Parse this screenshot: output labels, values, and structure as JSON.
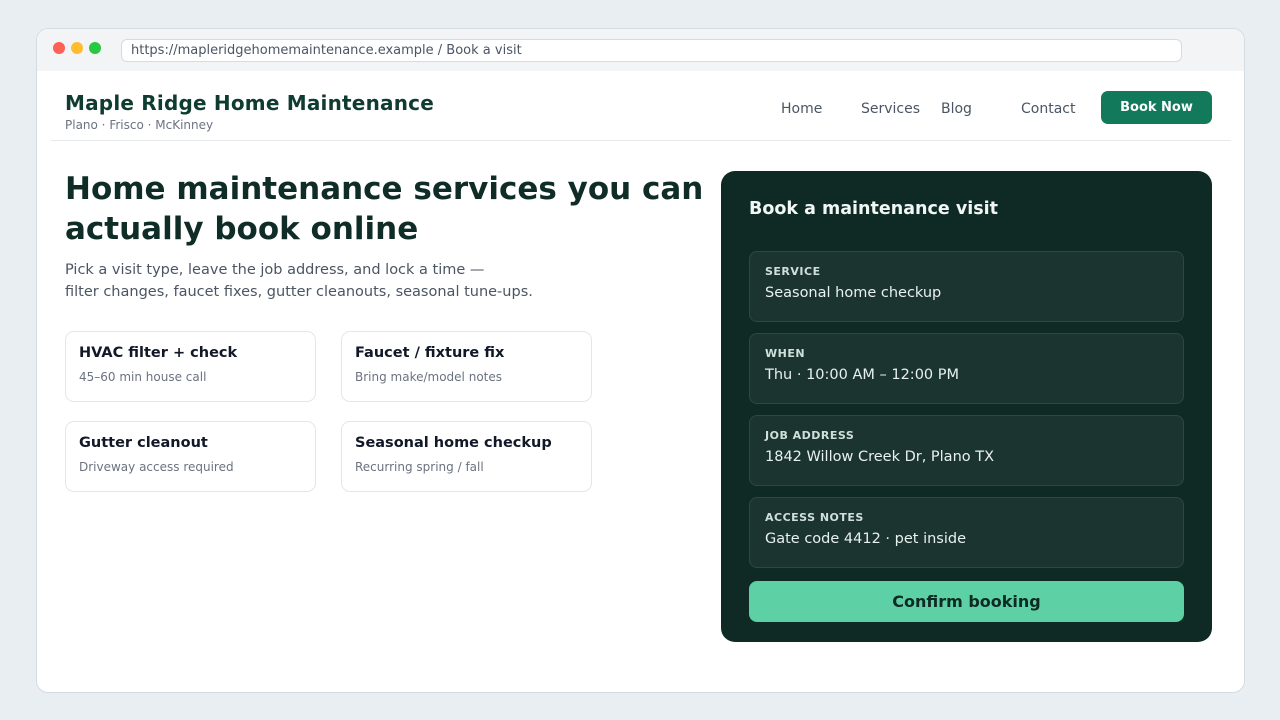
{
  "browser": {
    "url": "https://mapleridgehomemaintenance.example / Book a visit"
  },
  "header": {
    "brand": "Maple Ridge Home Maintenance",
    "locations": "Plano · Frisco · McKinney",
    "nav": [
      "Home",
      "Services",
      "Blog",
      "Contact"
    ],
    "cta_label": "Book Now"
  },
  "hero": {
    "title": "Home maintenance services you can actually book online",
    "subtitle_lines": [
      "Pick a visit type, leave the job address, and lock a time —",
      "filter changes, faucet fixes, gutter cleanouts, seasonal tune-ups."
    ]
  },
  "services": [
    {
      "title": "HVAC filter + check",
      "subtitle": "45–60 min house call"
    },
    {
      "title": "Faucet / fixture fix",
      "subtitle": "Bring make/model notes"
    },
    {
      "title": "Gutter cleanout",
      "subtitle": "Driveway access required"
    },
    {
      "title": "Seasonal home checkup",
      "subtitle": "Recurring spring / fall"
    }
  ],
  "booking": {
    "title": "Book a maintenance visit",
    "fields": [
      {
        "label": "SERVICE",
        "value": "Seasonal home checkup"
      },
      {
        "label": "WHEN",
        "value": "Thu · 10:00 AM – 12:00 PM"
      },
      {
        "label": "JOB ADDRESS",
        "value": "1842 Willow Creek Dr, Plano TX"
      },
      {
        "label": "ACCESS NOTES",
        "value": "Gate code 4412 · pet inside"
      }
    ],
    "confirm_label": "Confirm booking"
  },
  "colors": {
    "brand": "#0f3b30",
    "cta": "#127a5b",
    "panel": "#0f2925",
    "confirm": "#5dd0a5"
  }
}
